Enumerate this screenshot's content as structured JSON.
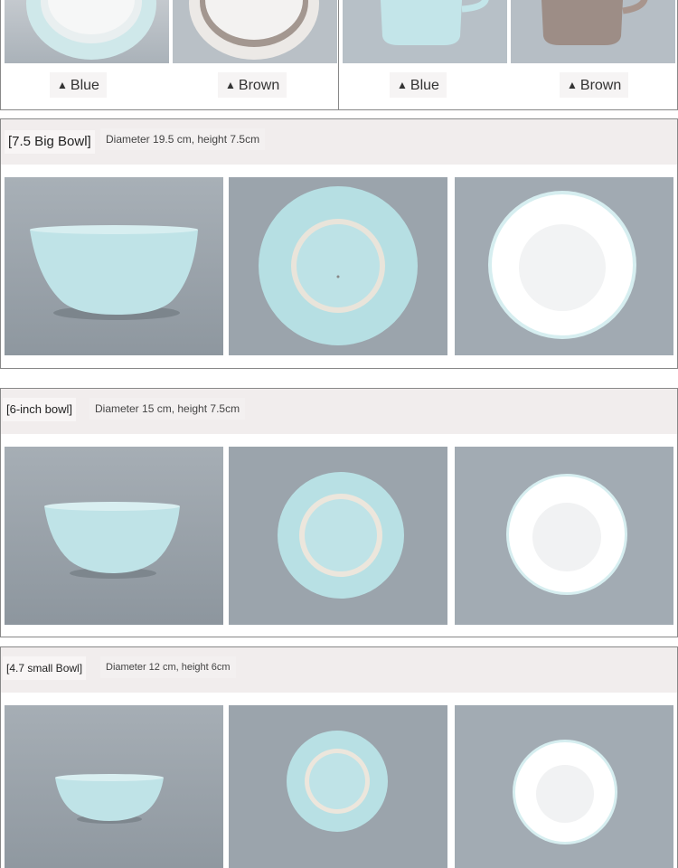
{
  "top": {
    "left_labels": [
      "Blue",
      "Brown"
    ],
    "right_labels": [
      "Blue",
      "Brown"
    ],
    "triangle": "▲"
  },
  "sections": [
    {
      "title": "[7.5 Big Bowl]",
      "spec": "Diameter 19.5 cm, height 7.5cm"
    },
    {
      "title": "[6-inch bowl]",
      "spec": "Diameter 15 cm, height 7.5cm"
    },
    {
      "title": "[4.7 small Bowl]",
      "spec": "Diameter 12 cm, height 6cm"
    }
  ],
  "colors": {
    "bowl_blue": "#bfe2e6",
    "bowl_white": "#f8f8f8",
    "bowl_brown": "#9c8a82",
    "backdrop": "#9ea7af",
    "header_bg": "#f1eded"
  }
}
